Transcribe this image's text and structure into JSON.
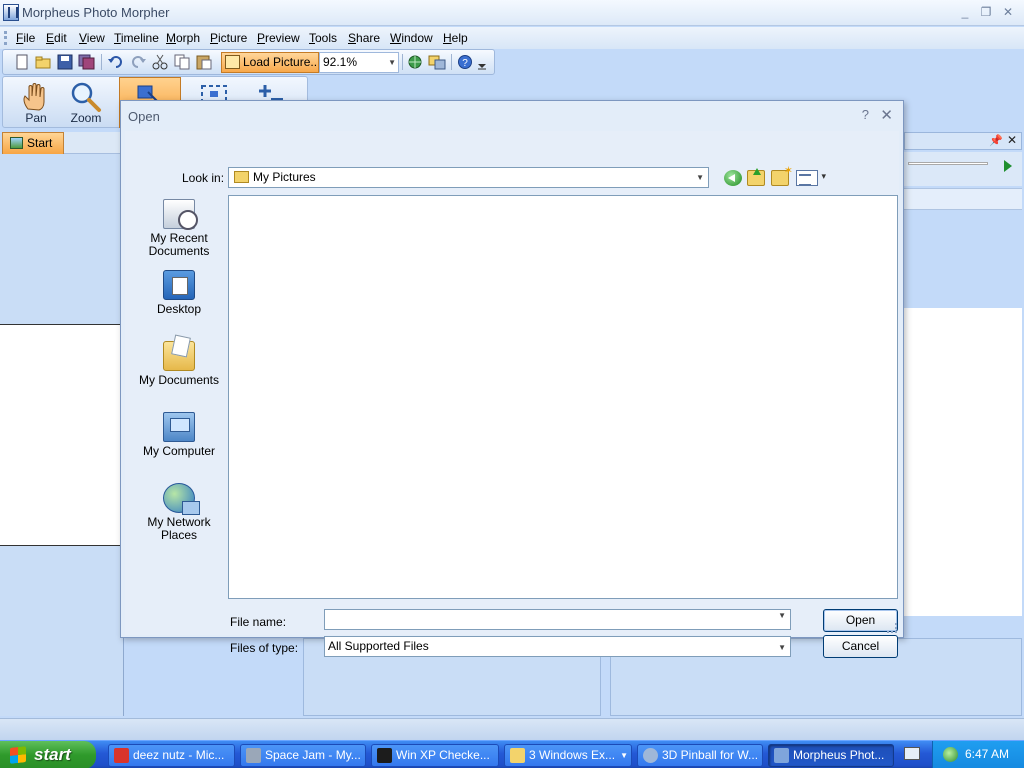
{
  "app": {
    "title": "Morpheus Photo Morpher",
    "window_controls": {
      "minimize": "_",
      "restore": "❐",
      "close": "✕"
    }
  },
  "menu": [
    {
      "label": "File",
      "u": "F",
      "rest": "ile"
    },
    {
      "label": "Edit",
      "u": "E",
      "rest": "dit"
    },
    {
      "label": "View",
      "u": "V",
      "rest": "iew"
    },
    {
      "label": "Timeline",
      "u": "T",
      "rest": "imeline"
    },
    {
      "label": "Morph",
      "u": "M",
      "rest": "orph"
    },
    {
      "label": "Picture",
      "u": "P",
      "rest": "icture"
    },
    {
      "label": "Preview",
      "u": "P",
      "rest": "review"
    },
    {
      "label": "Tools",
      "u": "T",
      "rest": "ools"
    },
    {
      "label": "Share",
      "u": "S",
      "rest": "hare"
    },
    {
      "label": "Window",
      "u": "W",
      "rest": "indow"
    },
    {
      "label": "Help",
      "u": "H",
      "rest": "elp"
    }
  ],
  "toolbar": {
    "load_picture_label": "Load Picture....",
    "zoom_value": "92.1%",
    "icons": [
      "new-icon",
      "open-icon",
      "save-icon",
      "save-all-icon",
      "undo-icon",
      "redo-icon",
      "cut-icon",
      "copy-icon",
      "paste-icon",
      "web-icon",
      "export-icon",
      "help-icon"
    ]
  },
  "tools": {
    "pan_label": "Pan",
    "zoom_label": "Zoom"
  },
  "panels": {
    "start_tab": "Start"
  },
  "dialog": {
    "title": "Open",
    "help_glyph": "?",
    "close_glyph": "✕",
    "look_in_label": "Look in:",
    "look_in_value": "My Pictures",
    "places": [
      {
        "line1": "My Recent",
        "line2": "Documents",
        "icon": "recent-documents-icon"
      },
      {
        "line1": "Desktop",
        "line2": "",
        "icon": "desktop-icon"
      },
      {
        "line1": "My Documents",
        "line2": "",
        "icon": "my-documents-icon"
      },
      {
        "line1": "My Computer",
        "line2": "",
        "icon": "my-computer-icon"
      },
      {
        "line1": "My Network",
        "line2": "Places",
        "icon": "my-network-places-icon"
      }
    ],
    "file_name_label": "File name:",
    "file_name_value": "",
    "files_of_type_label": "Files of type:",
    "files_of_type_value": "All Supported Files",
    "open_button": "Open",
    "cancel_button": "Cancel"
  },
  "taskbar": {
    "start_label": "start",
    "tasks": [
      {
        "label": "deez nutz - Mic...",
        "icon_color": "#d9342b"
      },
      {
        "label": "Space Jam - My...",
        "icon_color": "#9aa7b8"
      },
      {
        "label": "Win XP Checke...",
        "icon_color": "#1c1c1c"
      },
      {
        "label": "3 Windows Ex...",
        "icon_color": "#f3d36b"
      },
      {
        "label": "3D Pinball for W...",
        "icon_color": "#9fb7d8"
      },
      {
        "label": "Morpheus Phot...",
        "icon_color": "#7fa5dc"
      }
    ],
    "clock": "6:47 AM"
  },
  "colors": {
    "accent_orange": "#f7a544",
    "taskbar_blue": "#2459d6",
    "start_green": "#2f9a2b"
  }
}
